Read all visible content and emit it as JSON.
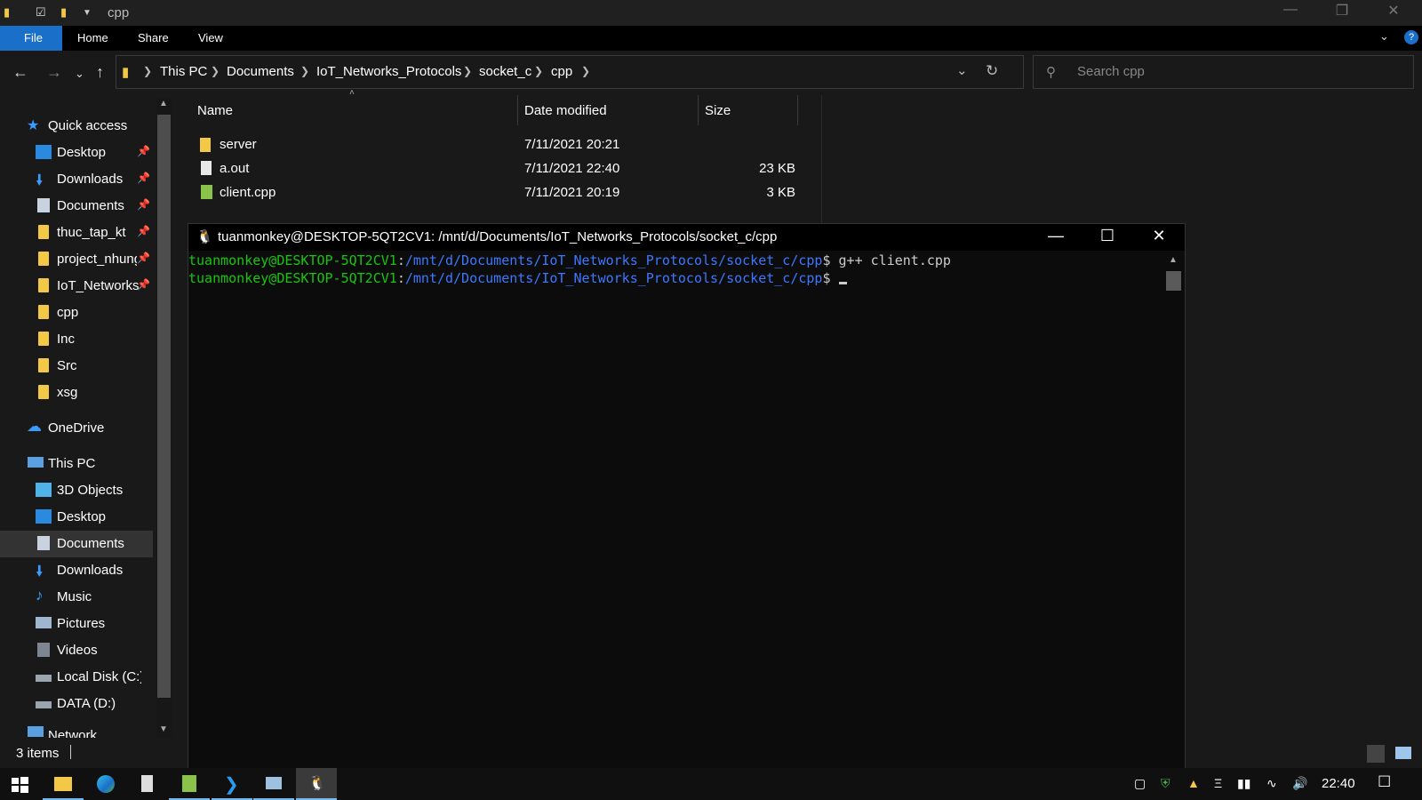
{
  "explorer": {
    "title": "cpp",
    "ribbon_tabs": [
      "File",
      "Home",
      "Share",
      "View"
    ],
    "breadcrumb": [
      "This PC",
      "Documents",
      "IoT_Networks_Protocols",
      "socket_c",
      "cpp"
    ],
    "search_placeholder": "Search cpp",
    "columns": [
      "Name",
      "Date modified",
      "Size"
    ],
    "files": [
      {
        "name": "server",
        "date": "7/11/2021 20:21",
        "size": "",
        "icon": "folder-icon"
      },
      {
        "name": "a.out",
        "date": "7/11/2021 22:40",
        "size": "23 KB",
        "icon": "file-icon"
      },
      {
        "name": "client.cpp",
        "date": "7/11/2021 20:19",
        "size": "3 KB",
        "icon": "cpp-file-icon"
      }
    ],
    "status": "3 items"
  },
  "sidebar": {
    "quick_access": "Quick access",
    "pinned": [
      "Desktop",
      "Downloads",
      "Documents",
      "thuc_tap_kt",
      "project_nhung",
      "IoT_Networks"
    ],
    "recent": [
      "cpp",
      "Inc",
      "Src",
      "xsg"
    ],
    "onedrive": "OneDrive",
    "this_pc": "This PC",
    "pc_items": [
      "3D Objects",
      "Desktop",
      "Documents",
      "Downloads",
      "Music",
      "Pictures",
      "Videos",
      "Local Disk (C:)",
      "DATA (D:)"
    ],
    "network": "Network",
    "selected": "Documents"
  },
  "terminal": {
    "title": "tuanmonkey@DESKTOP-5QT2CV1: /mnt/d/Documents/IoT_Networks_Protocols/socket_c/cpp",
    "user": "tuanmonkey@DESKTOP-5QT2CV1",
    "path": "/mnt/d/Documents/IoT_Networks_Protocols/socket_c/cpp",
    "lines": [
      {
        "command": "g++ client.cpp"
      },
      {
        "command": ""
      }
    ],
    "colors": {
      "user": "#16c60c",
      "path": "#3b78ff"
    }
  },
  "taskbar": {
    "clock": "22:40",
    "apps": [
      "start-icon",
      "file-explorer-icon",
      "edge-icon",
      "calculator-icon",
      "notepad-icon",
      "vscode-icon",
      "remote-icon",
      "ubuntu-icon"
    ]
  }
}
